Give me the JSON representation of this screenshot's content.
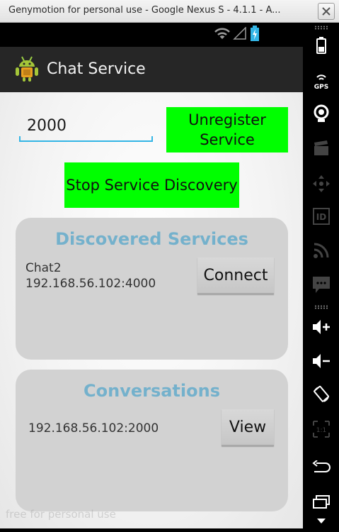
{
  "window": {
    "title": "Genymotion for personal use - Google Nexus S - 4.1.1 - A..."
  },
  "status_bar": {
    "icons": [
      "wifi-icon",
      "signal-icon",
      "battery-charging-icon"
    ]
  },
  "action_bar": {
    "app_title": "Chat Service",
    "app_icon": "android-robot-icon"
  },
  "port_input": {
    "value": "2000"
  },
  "buttons": {
    "unregister": "Unregister Service",
    "stop_discovery": "Stop Service Discovery",
    "connect": "Connect",
    "view": "View"
  },
  "discovered": {
    "title": "Discovered Services",
    "service_name": "Chat2",
    "service_address": "192.168.56.102:4000"
  },
  "conversations": {
    "title": "Conversations",
    "address": "192.168.56.102:2000"
  },
  "watermark": "free for personal use",
  "toolbar": {
    "items": [
      "battery-icon",
      "gps-icon",
      "camera-icon",
      "video-icon",
      "dpad-icon",
      "id-icon",
      "rss-icon",
      "sms-icon",
      "volume-up-icon",
      "volume-down-icon",
      "rotate-icon",
      "scale-icon",
      "back-icon",
      "recent-apps-icon",
      "menu-icon"
    ]
  },
  "colors": {
    "accent_green": "#00ff00",
    "panel_gray": "#d2d2d2",
    "title_blue": "#74b1cc",
    "input_blue": "#33b5e5"
  }
}
